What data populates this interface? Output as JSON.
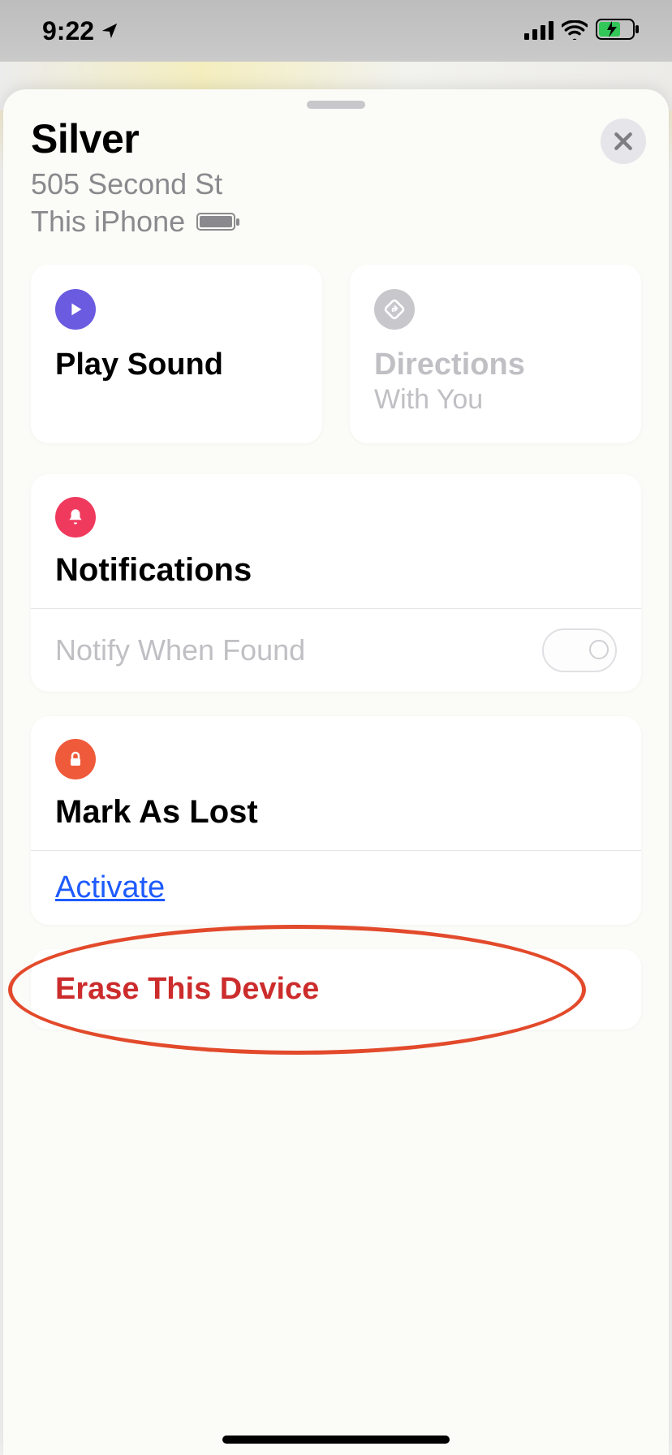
{
  "status": {
    "time": "9:22"
  },
  "device": {
    "name": "Silver",
    "address": "505 Second St",
    "subtitle": "This iPhone"
  },
  "actions": {
    "play_sound": {
      "label": "Play Sound"
    },
    "directions": {
      "label": "Directions",
      "sub": "With You"
    }
  },
  "notifications": {
    "title": "Notifications",
    "notify_when_found": "Notify When Found"
  },
  "mark_lost": {
    "title": "Mark As Lost",
    "activate": "Activate"
  },
  "erase": {
    "label": "Erase This Device"
  },
  "colors": {
    "accent_purple": "#6a5be0",
    "accent_red": "#ef3a5d",
    "accent_orange": "#ef5a3a",
    "danger": "#cc2c2c",
    "link": "#1e5bff"
  }
}
